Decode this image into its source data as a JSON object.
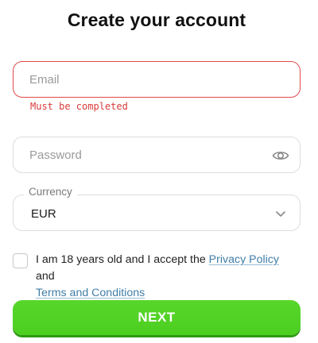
{
  "form": {
    "title": "Create your account",
    "email": {
      "placeholder": "Email",
      "value": "",
      "error": "Must be completed"
    },
    "password": {
      "placeholder": "Password",
      "value": ""
    },
    "currency": {
      "label": "Currency",
      "value": "EUR"
    },
    "consent": {
      "checked": false,
      "text_before": "I am 18 years old and I accept the ",
      "privacy_link": "Privacy Policy",
      "text_and": " and",
      "terms_link": "Terms and Conditions"
    },
    "next_label": "NEXT"
  },
  "colors": {
    "error": "#e04a4a",
    "accent_green": "#4ccf20",
    "link": "#3f7ea8"
  },
  "icons": {
    "password_toggle": "eye-icon",
    "select": "chevron-down-icon"
  }
}
